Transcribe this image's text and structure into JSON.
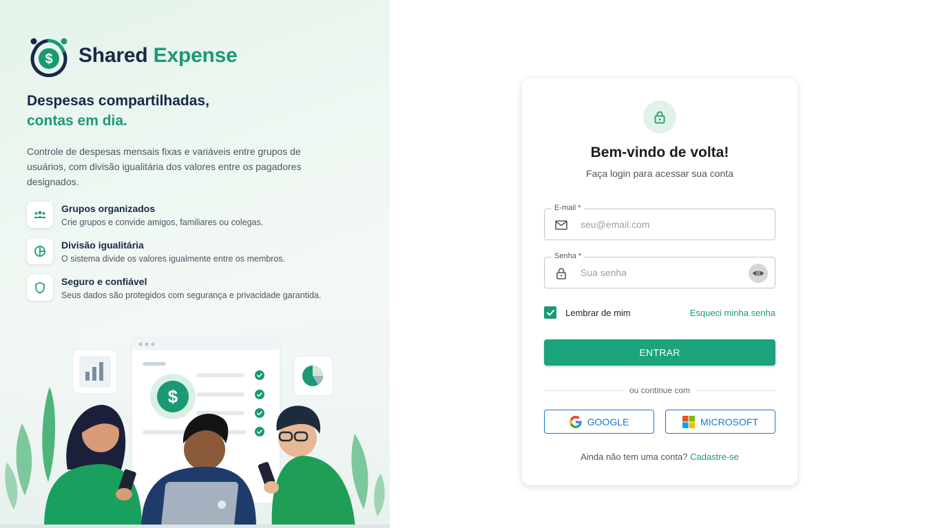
{
  "brand": {
    "name_part1": "Shared",
    "name_part2": "Expense"
  },
  "hero": {
    "headline_line1": "Despesas compartilhadas,",
    "headline_line2": "contas em dia.",
    "description": "Controle de despesas mensais fixas e variáveis entre grupos de usuários, com divisão igualitária dos valores entre os pagadores designados."
  },
  "features": [
    {
      "title": "Grupos organizados",
      "subtitle": "Crie grupos e convide amigos, familiares ou colegas.",
      "icon": "group-icon"
    },
    {
      "title": "Divisão igualitária",
      "subtitle": "O sistema divide os valores igualmente entre os membros.",
      "icon": "pie-split-icon"
    },
    {
      "title": "Seguro e confiável",
      "subtitle": "Seus dados são protegidos com segurança e privacidade garantida.",
      "icon": "shield-icon"
    }
  ],
  "login": {
    "title": "Bem-vindo de volta!",
    "subtitle": "Faça login para acessar sua conta",
    "email_label": "E-mail *",
    "email_placeholder": "seu@email.com",
    "password_label": "Senha *",
    "password_placeholder": "Sua senha",
    "remember_label": "Lembrar de mim",
    "remember_checked": true,
    "forgot_label": "Esqueci minha senha",
    "submit_label": "ENTRAR",
    "divider_label": "ou continue com",
    "google_label": "GOOGLE",
    "microsoft_label": "MICROSOFT",
    "signup_prompt": "Ainda não tem uma conta?",
    "signup_link": "Cadastre-se"
  },
  "colors": {
    "brand_green": "#1a9a74",
    "brand_navy": "#17284a",
    "button_green": "#1aa37c",
    "social_blue": "#1976d2"
  }
}
